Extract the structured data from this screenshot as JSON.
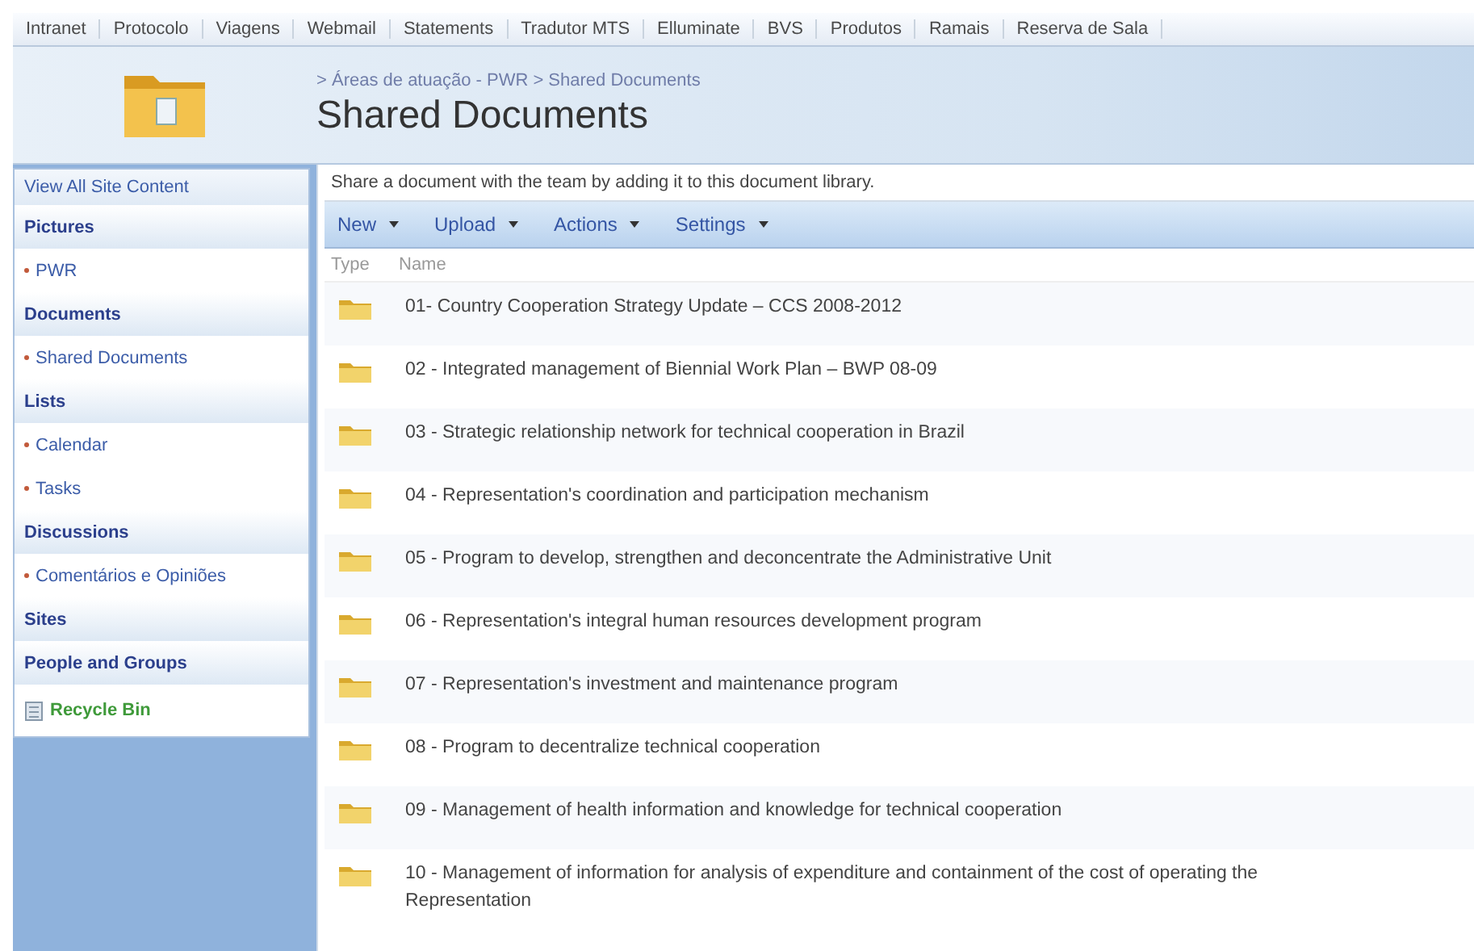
{
  "top_nav": [
    "Intranet",
    "Protocolo",
    "Viagens",
    "Webmail",
    "Statements",
    "Tradutor MTS",
    "Elluminate",
    "BVS",
    "Produtos",
    "Ramais",
    "Reserva de Sala"
  ],
  "header": {
    "breadcrumb": "> Áreas de atuação - PWR > Shared Documents",
    "title": "Shared Documents"
  },
  "sidebar": [
    {
      "kind": "link",
      "label": "View All Site Content"
    },
    {
      "kind": "heading",
      "label": "Pictures"
    },
    {
      "kind": "item",
      "label": "PWR"
    },
    {
      "kind": "heading",
      "label": "Documents"
    },
    {
      "kind": "item",
      "label": "Shared Documents"
    },
    {
      "kind": "heading",
      "label": "Lists"
    },
    {
      "kind": "item",
      "label": "Calendar"
    },
    {
      "kind": "item",
      "label": "Tasks"
    },
    {
      "kind": "heading",
      "label": "Discussions"
    },
    {
      "kind": "item",
      "label": "Comentários e Opiniões"
    },
    {
      "kind": "heading",
      "label": "Sites"
    },
    {
      "kind": "heading",
      "label": "People and Groups"
    },
    {
      "kind": "recycle",
      "label": "Recycle Bin"
    }
  ],
  "description": "Share a document with the team by adding it to this document library.",
  "toolbar": [
    {
      "label": "New"
    },
    {
      "label": "Upload"
    },
    {
      "label": "Actions"
    },
    {
      "label": "Settings"
    }
  ],
  "table": {
    "columns": [
      "Type",
      "Name"
    ],
    "rows": [
      {
        "name": "01- Country Cooperation Strategy Update – CCS 2008-2012"
      },
      {
        "name": "02 - Integrated management of Biennial Work Plan – BWP 08-09"
      },
      {
        "name": "03 - Strategic relationship network for technical cooperation in Brazil"
      },
      {
        "name": "04 - Representation's coordination and participation mechanism"
      },
      {
        "name": "05 - Program to develop, strengthen and deconcentrate the Administrative Unit"
      },
      {
        "name": "06 - Representation's integral human resources development program"
      },
      {
        "name": "07 - Representation's investment and maintenance program"
      },
      {
        "name": "08 - Program to decentralize technical cooperation"
      },
      {
        "name": "09 - Management of health information and knowledge for technical cooperation"
      },
      {
        "name": "10 - Management of information for analysis of expenditure and containment of the cost of operating the Representation"
      }
    ]
  }
}
